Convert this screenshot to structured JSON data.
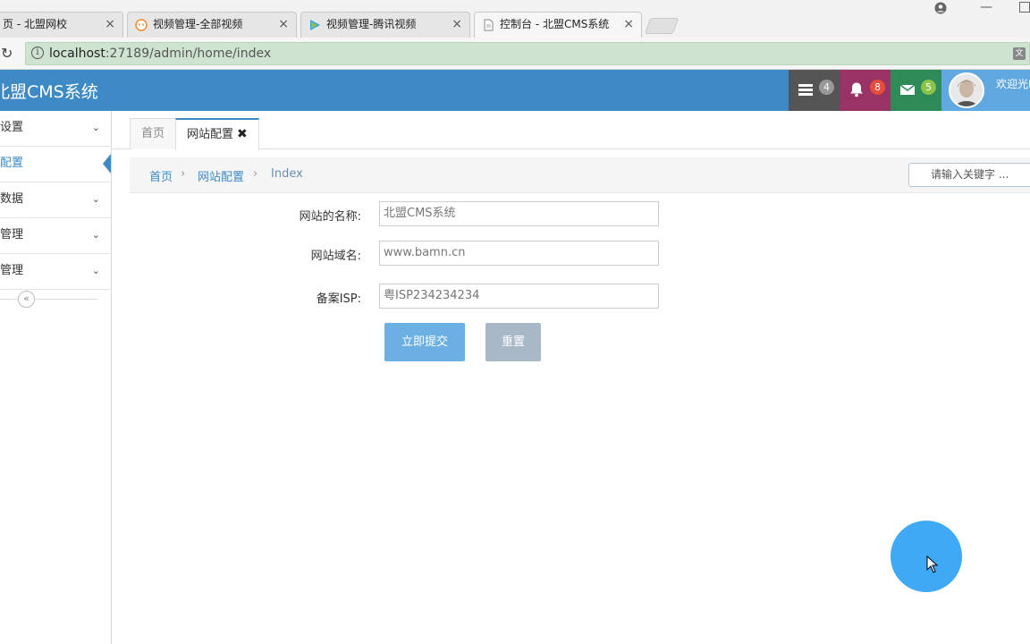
{
  "browser": {
    "tabs": [
      {
        "label": "页 - 北盟网校",
        "close": "×",
        "icon": "page-icon"
      },
      {
        "label": "视频管理-全部视频",
        "close": "×",
        "icon": "bilibili-icon"
      },
      {
        "label": "视频管理-腾讯视频",
        "close": "×",
        "icon": "tencent-video-icon"
      },
      {
        "label": "控制台 - 北盟CMS系统",
        "close": "×",
        "icon": "document-icon",
        "active": true
      }
    ],
    "url_host": "localhost",
    "url_path": ":27189/admin/home/index"
  },
  "header": {
    "brand": "北盟CMS系统",
    "tasks_count": "4",
    "notifications_count": "8",
    "messages_count": "5",
    "welcome": "欢迎光临",
    "colors": {
      "header": "#3d8ac5",
      "tasks": "#555555",
      "notifications": "#993366",
      "messages": "#2e8b57"
    }
  },
  "sidebar": {
    "items": [
      {
        "label": "设置",
        "chevron": "⌄"
      },
      {
        "label": "配置",
        "active": true
      },
      {
        "label": "数据",
        "chevron": "⌄"
      },
      {
        "label": "管理",
        "chevron": "⌄"
      },
      {
        "label": "管理",
        "chevron": "⌄"
      }
    ],
    "collapse": "«"
  },
  "content_tabs": {
    "home": "首页",
    "config": "网站配置",
    "close": "✖"
  },
  "breadcrumb": {
    "home": "首页",
    "section": "网站配置",
    "current": "Index",
    "sep": "›"
  },
  "search": {
    "placeholder": "请输入关键字 ..."
  },
  "form": {
    "name_label": "网站的名称:",
    "name_value": "北盟CMS系统",
    "domain_label": "网站域名:",
    "domain_value": "www.bamn.cn",
    "isp_label": "备案ISP:",
    "isp_value": "粤ISP234234234",
    "submit": "立即提交",
    "reset": "重置"
  }
}
